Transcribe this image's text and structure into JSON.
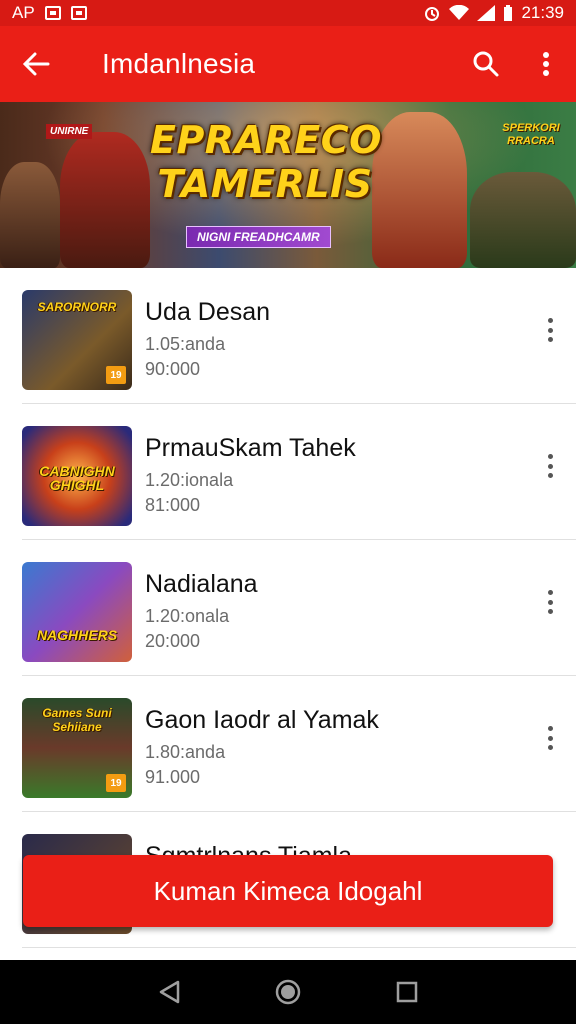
{
  "status_bar": {
    "left_text": "AP",
    "time": "21:39"
  },
  "app_bar": {
    "title": "Imdanlnesia",
    "back_icon": "arrow-left-icon",
    "search_icon": "search-icon",
    "menu_icon": "more-vert-icon"
  },
  "banner": {
    "title_line1": "EPRARECO",
    "title_line2": "TAMERLIS",
    "subtitle": "NIGNI FREADHCAMR",
    "badge_left": "UNIRNE",
    "badge_right": "SPERKORI RRACRA"
  },
  "games": [
    {
      "title": "Uda Desan",
      "line1": "1.05:anda",
      "line2": "90:000",
      "thumb_label": "SARORNORR",
      "tag": "19"
    },
    {
      "title": "PrmauSkam Tahek",
      "line1": "1.20:ionala",
      "line2": "81:000",
      "thumb_label": "CABNIGHN GHIGHL",
      "tag": ""
    },
    {
      "title": "Nadialana",
      "line1": "1.20:onala",
      "line2": "20:000",
      "thumb_label": "NAGHHERS",
      "tag": ""
    },
    {
      "title": "Gaon Iaodr al Yamak",
      "line1": "1.80:anda",
      "line2": "91.000",
      "thumb_label": "Games Suni Sehiiane",
      "tag": "19"
    }
  ],
  "partial_item": {
    "title": "Sgmtrlnans Tiamla"
  },
  "cta": {
    "label": "Kuman Kimeca Idogahl"
  },
  "colors": {
    "primary": "#ea1f17",
    "status": "#d71a14"
  }
}
